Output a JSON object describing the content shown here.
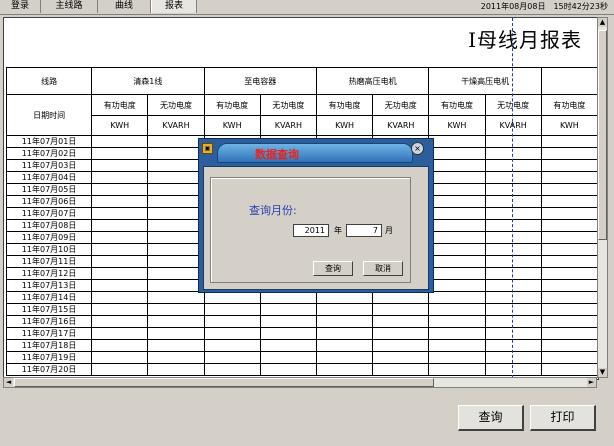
{
  "tabs": [
    {
      "label": "登录"
    },
    {
      "label": "主线路"
    },
    {
      "label": "曲线"
    },
    {
      "label": "报表"
    }
  ],
  "datetime": "2011年08月08日　15时42分23秒",
  "report": {
    "title": "I母线月报表",
    "row_header": "线路",
    "date_header": "日期时间",
    "lines": [
      "清森1线",
      "至电容器",
      "热磨高压电机",
      "干燥高压电机",
      ""
    ],
    "power_labels": [
      "有功电度",
      "无功电度"
    ],
    "unit_labels": [
      "KWH",
      "KVARH"
    ],
    "dates": [
      "11年07月01日",
      "11年07月02日",
      "11年07月03日",
      "11年07月04日",
      "11年07月05日",
      "11年07月06日",
      "11年07月07日",
      "11年07月08日",
      "11年07月09日",
      "11年07月10日",
      "11年07月11日",
      "11年07月12日",
      "11年07月13日",
      "11年07月14日",
      "11年07月15日",
      "11年07月16日",
      "11年07月17日",
      "11年07月18日",
      "11年07月19日",
      "11年07月20日"
    ]
  },
  "buttons": {
    "query": "查询",
    "print": "打印"
  },
  "dialog": {
    "title": "数据查询",
    "label": "查询月份:",
    "year_value": "2011",
    "year_unit": "年",
    "month_value": "7",
    "month_unit": "月",
    "query_button": "查询",
    "cancel_button": "取消",
    "close_icon": "×"
  }
}
